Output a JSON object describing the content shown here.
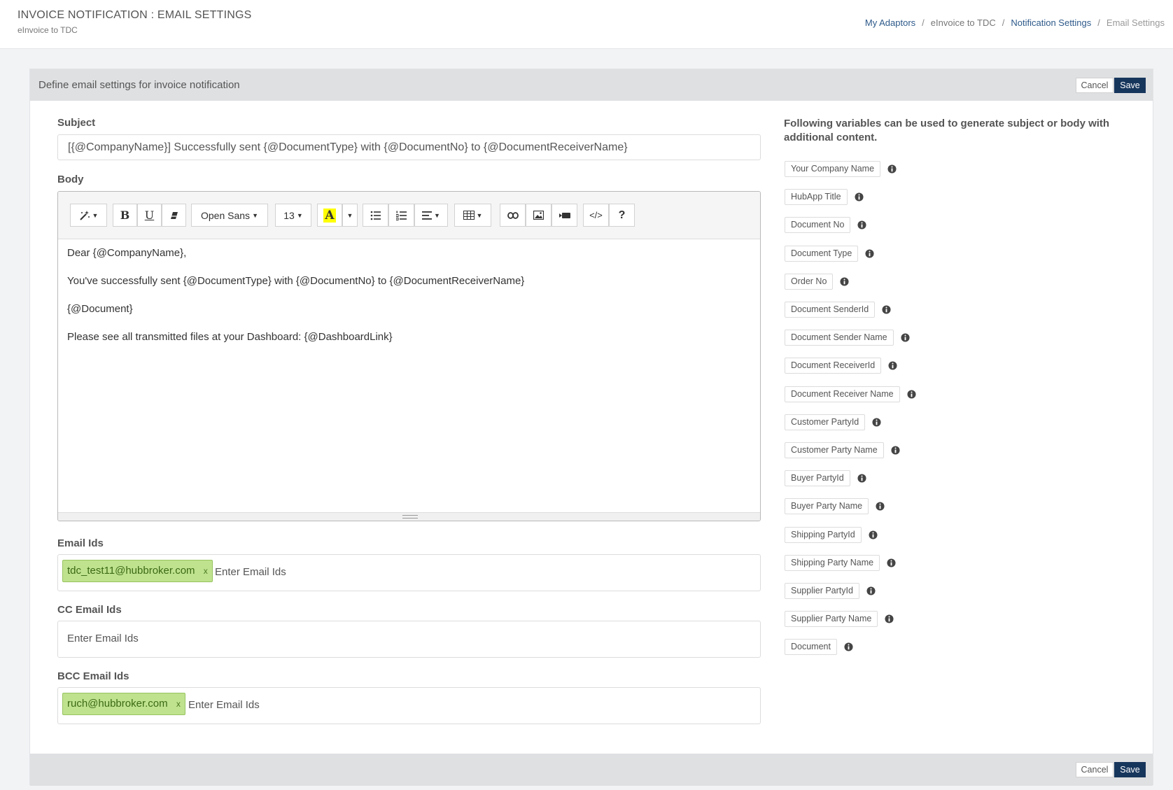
{
  "header": {
    "title": "INVOICE NOTIFICATION : EMAIL SETTINGS",
    "subtitle": "eInvoice to TDC",
    "breadcrumb": [
      "My Adaptors",
      "eInvoice to TDC",
      "Notification Settings",
      "Email Settings"
    ]
  },
  "panel": {
    "title": "Define email settings for invoice notification",
    "cancel_label": "Cancel",
    "save_label": "Save"
  },
  "subject": {
    "label": "Subject",
    "value": "[{@CompanyName}] Successfully sent {@DocumentType} with {@DocumentNo} to {@DocumentReceiverName}"
  },
  "body": {
    "label": "Body",
    "toolbar": {
      "font_name": "Open Sans",
      "font_size": "13",
      "bold": "B",
      "underline": "U",
      "color_letter": "A",
      "code": "</>",
      "help": "?"
    },
    "lines": [
      "Dear {@CompanyName},",
      "You've successfully sent {@DocumentType} with {@DocumentNo} to {@DocumentReceiverName}",
      "{@Document}",
      "Please see all transmitted files at your Dashboard: {@DashboardLink}"
    ]
  },
  "email_ids": {
    "label": "Email Ids",
    "tags": [
      "tdc_test11@hubbroker.com"
    ],
    "placeholder": "Enter Email Ids"
  },
  "cc_email_ids": {
    "label": "CC Email Ids",
    "placeholder": "Enter Email Ids"
  },
  "bcc_email_ids": {
    "label": "BCC Email Ids",
    "tags": [
      "ruch@hubbroker.com"
    ],
    "placeholder": "Enter Email Ids"
  },
  "variables": {
    "heading": "Following variables can be used to generate subject or body with additional content.",
    "items": [
      "Your Company Name",
      "HubApp Title",
      "Document No",
      "Document Type",
      "Order No",
      "Document SenderId",
      "Document Sender Name",
      "Document ReceiverId",
      "Document Receiver Name",
      "Customer PartyId",
      "Customer Party Name",
      "Buyer PartyId",
      "Buyer Party Name",
      "Shipping PartyId",
      "Shipping Party Name",
      "Supplier PartyId",
      "Supplier Party Name",
      "Document"
    ]
  },
  "colors": {
    "save_button": "#17365c",
    "tag_background": "#bfe28f",
    "link": "#2e5a8a",
    "color_picker_highlight": "#ffff00"
  },
  "tag_remove_glyph": "x"
}
